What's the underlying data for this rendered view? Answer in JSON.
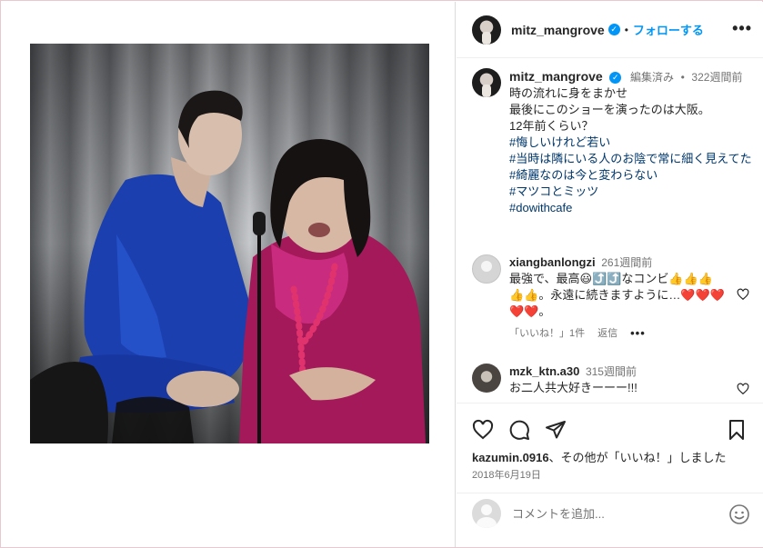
{
  "post": {
    "username": "mitz_mangrove",
    "follow_label": "フォローする",
    "separator": "•",
    "more_label": "•••"
  },
  "caption": {
    "username": "mitz_mangrove",
    "edited": "編集済み",
    "separator": "•",
    "time": "322週間前",
    "lines": [
      "時の流れに身をまかせ",
      "最後にこのショーを演ったのは大阪。",
      "12年前くらい？"
    ],
    "hashtags": [
      "#悔しいけれど若い",
      "#当時は隣にいる人のお陰で常に細く見えてた",
      "#綺麗なのは今と変わらない",
      "#マツコとミッツ",
      "#dowithcafe"
    ]
  },
  "comments": [
    {
      "username": "xiangbanlongzi",
      "time": "261週間前",
      "text": "最強で、最高😃⤴️⤴️なコンビ👍👍👍👍👍。永遠に続きますように…❤️❤️❤️❤️❤️。",
      "likes_label": "「いいね！」1件",
      "reply_label": "返信",
      "more_label": "•••"
    },
    {
      "username": "mzk_ktn.a30",
      "time": "315週間前",
      "text": "お二人共大好きーーー!!!"
    }
  ],
  "likes": {
    "user": "kazumin.0916",
    "suffix": "、その他が「いいね！」しました"
  },
  "date": "2018年6月19日",
  "add_comment": {
    "placeholder": "コメントを追加..."
  },
  "icons": {
    "heart": "heart-icon",
    "comment": "comment-icon",
    "share": "share-icon",
    "save": "bookmark-icon",
    "emoji": "emoji-icon"
  },
  "colors": {
    "link_blue": "#0095f6",
    "hashtag": "#00376b",
    "muted": "#737373"
  }
}
